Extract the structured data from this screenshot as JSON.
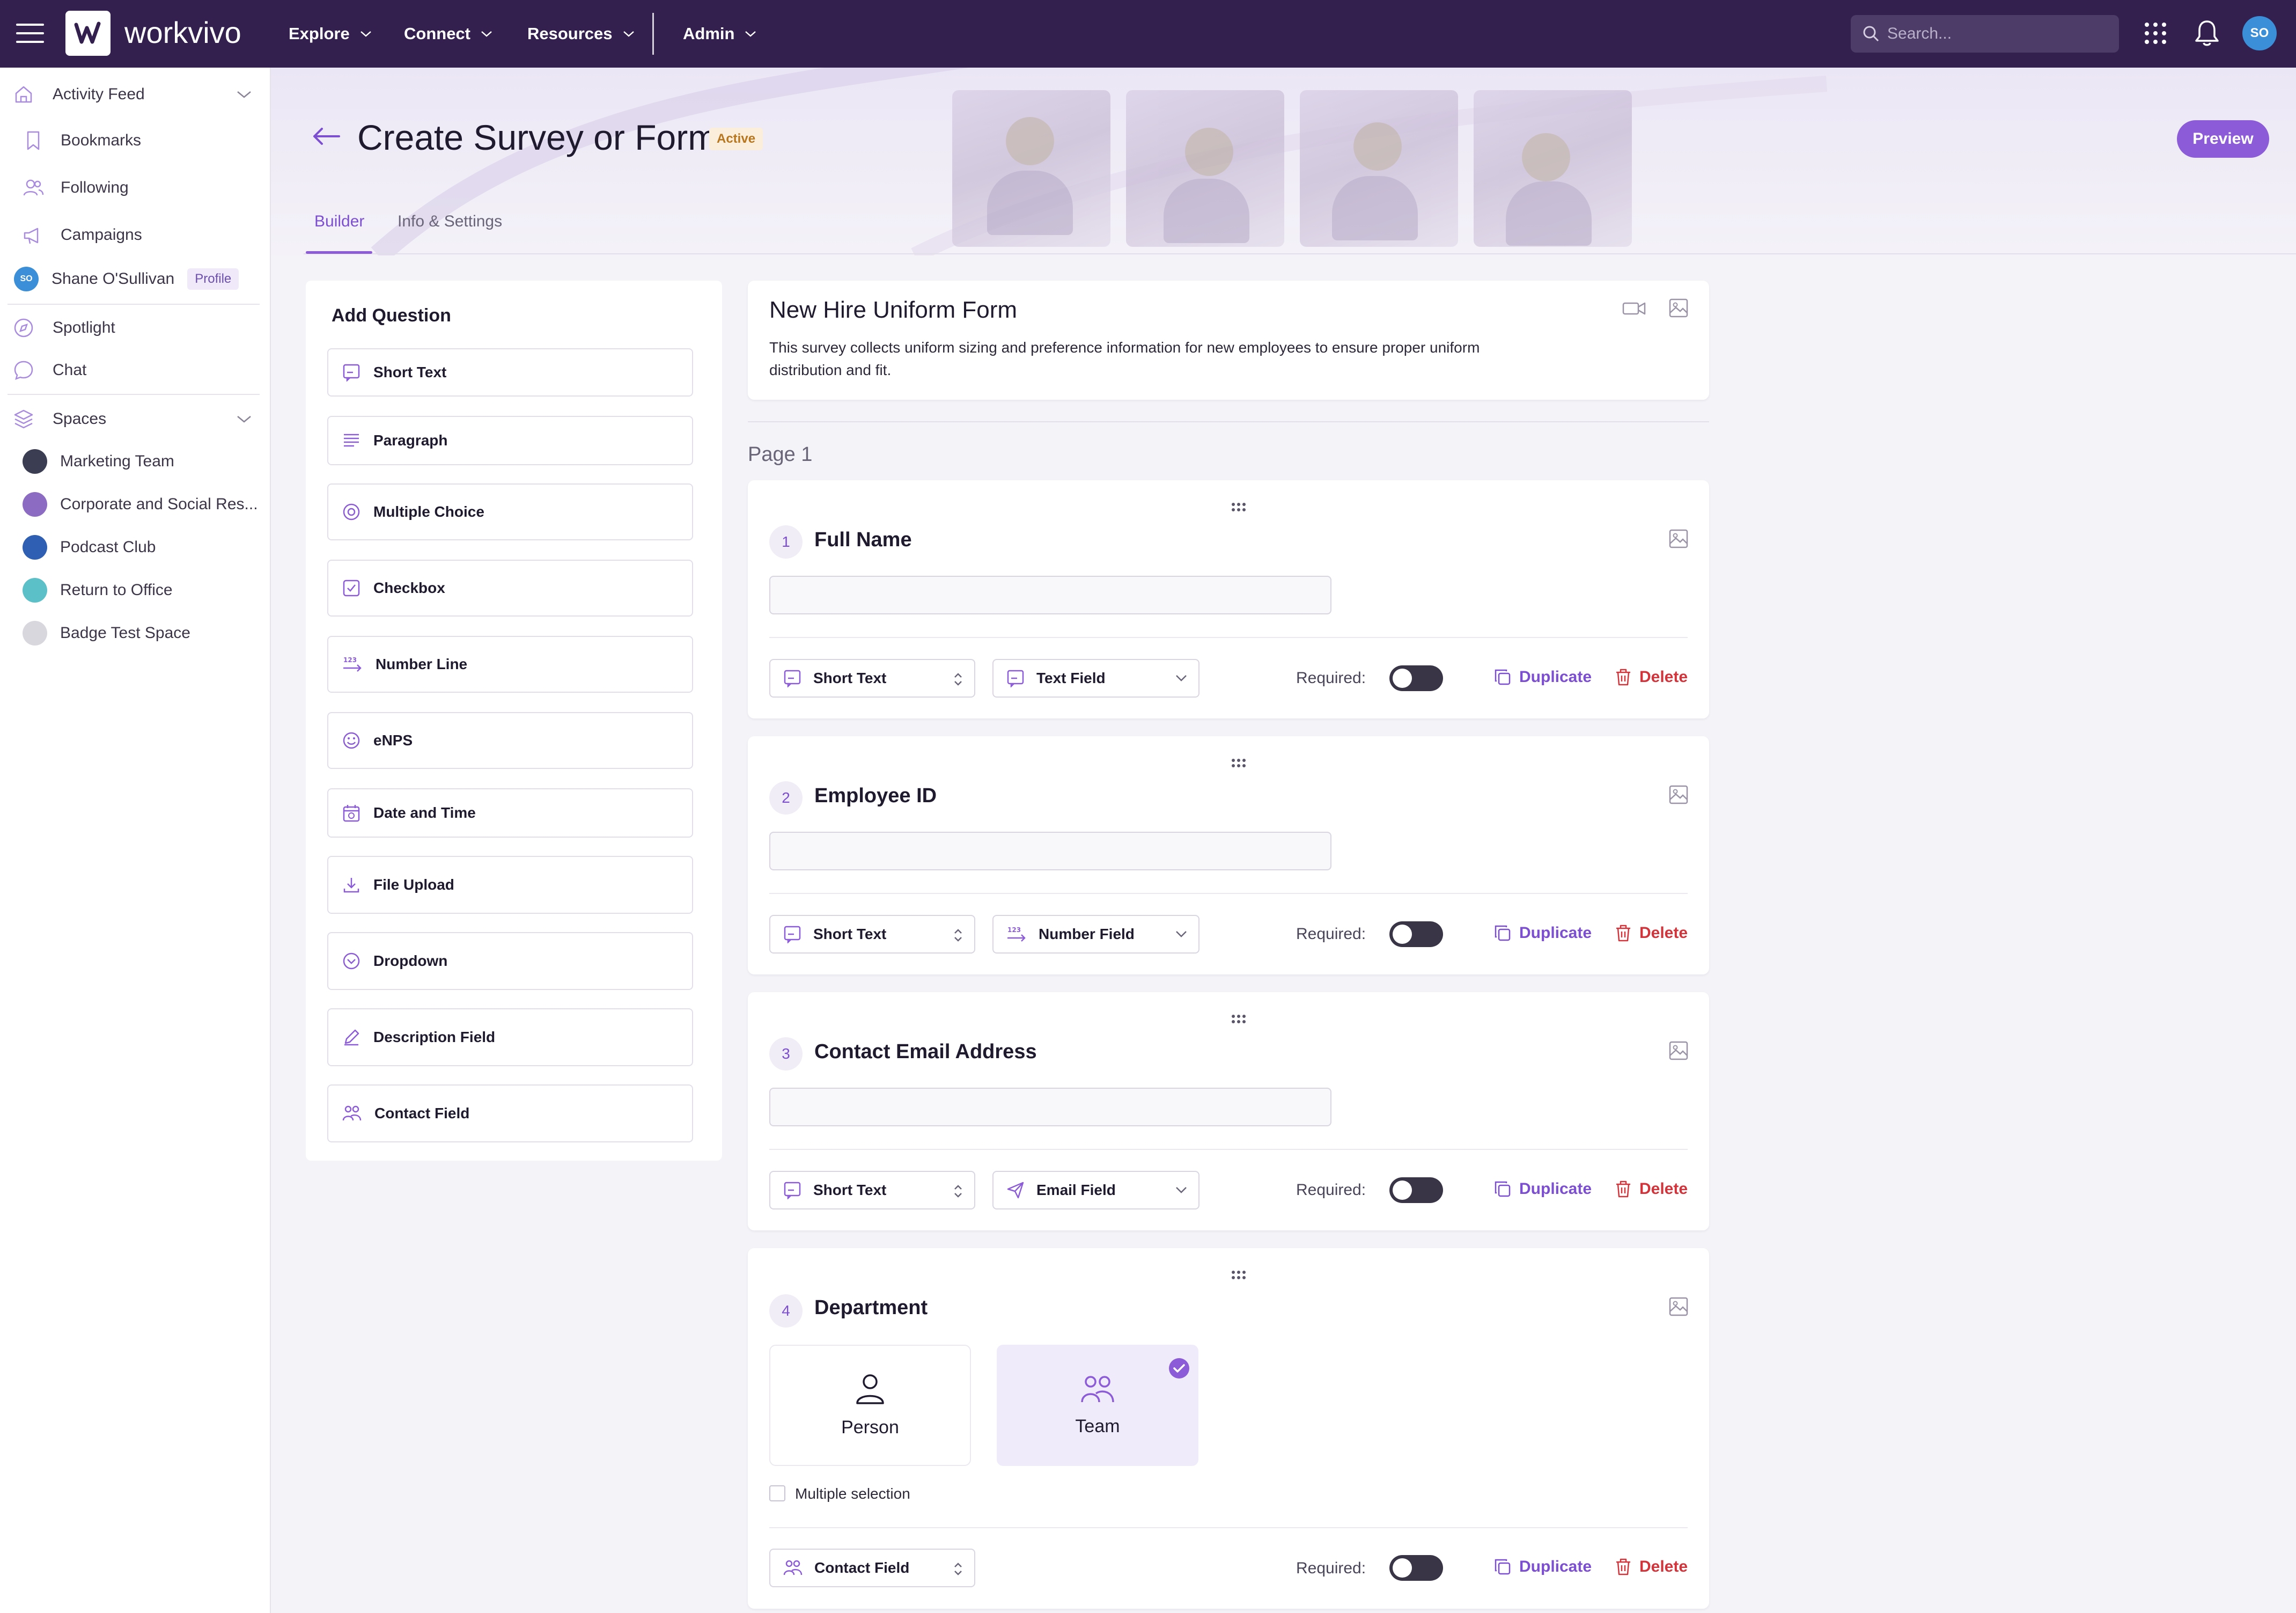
{
  "app": {
    "brand": "workvivo",
    "nav": [
      "Explore",
      "Connect",
      "Resources",
      "Admin"
    ],
    "search_placeholder": "Search...",
    "user_initials": "SO"
  },
  "sidebar": {
    "items": [
      {
        "label": "Activity Feed",
        "icon": "home-icon"
      },
      {
        "label": "Bookmarks",
        "icon": "bookmark-icon"
      },
      {
        "label": "Following",
        "icon": "users-icon"
      },
      {
        "label": "Campaigns",
        "icon": "megaphone-icon"
      }
    ],
    "profile": {
      "name": "Shane O'Sullivan",
      "badge": "Profile",
      "initials": "SO"
    },
    "items2": [
      {
        "label": "Spotlight",
        "icon": "compass-icon"
      },
      {
        "label": "Chat",
        "icon": "chat-icon"
      }
    ],
    "spaces_label": "Spaces",
    "spaces": [
      {
        "label": "Marketing Team",
        "color": "#3b3d52"
      },
      {
        "label": "Corporate and Social Res...",
        "color": "#8c6bc2"
      },
      {
        "label": "Podcast Club",
        "color": "#2f5fb3"
      },
      {
        "label": "Return to Office",
        "color": "#5cc0c8"
      },
      {
        "label": "Badge Test Space",
        "color": "#d9d7de"
      }
    ]
  },
  "header": {
    "title": "Create Survey or Form",
    "status": "Active",
    "preview_label": "Preview",
    "tabs": [
      "Builder",
      "Info & Settings"
    ],
    "active_tab": "Builder"
  },
  "add_question": {
    "title": "Add Question",
    "items": [
      {
        "label": "Short Text",
        "icon": "short-text-icon"
      },
      {
        "label": "Paragraph",
        "icon": "paragraph-icon"
      },
      {
        "label": "Multiple Choice",
        "icon": "radio-icon"
      },
      {
        "label": "Checkbox",
        "icon": "checkbox-icon"
      },
      {
        "label": "Number Line",
        "icon": "number-line-icon"
      },
      {
        "label": "eNPS",
        "icon": "smiley-icon"
      },
      {
        "label": "Date and Time",
        "icon": "calendar-icon"
      },
      {
        "label": "File Upload",
        "icon": "upload-icon"
      },
      {
        "label": "Dropdown",
        "icon": "dropdown-icon"
      },
      {
        "label": "Description Field",
        "icon": "pencil-icon"
      },
      {
        "label": "Contact Field",
        "icon": "contact-icon"
      }
    ]
  },
  "form": {
    "title": "New Hire Uniform Form",
    "description": "This survey collects uniform sizing and preference information for new employees to ensure proper uniform distribution and fit.",
    "page_label": "Page 1"
  },
  "questions": [
    {
      "number": "1",
      "title": "Full Name",
      "type": "Short Text",
      "subtype": "Text Field",
      "required_label": "Required:",
      "required": false
    },
    {
      "number": "2",
      "title": "Employee ID",
      "type": "Short Text",
      "subtype": "Number Field",
      "required_label": "Required:",
      "required": false
    },
    {
      "number": "3",
      "title": "Contact Email Address",
      "type": "Short Text",
      "subtype": "Email Field",
      "required_label": "Required:",
      "required": false
    },
    {
      "number": "4",
      "title": "Department",
      "type": "Contact Field",
      "required_label": "Required:",
      "required": false,
      "options": [
        "Person",
        "Team"
      ],
      "selected_option": "Team",
      "multiple_selection_label": "Multiple selection",
      "multiple_selection": false
    }
  ],
  "actions": {
    "duplicate": "Duplicate",
    "delete": "Delete"
  },
  "colors": {
    "topbar": "#33204f",
    "accent": "#8c5bd8",
    "danger": "#d1343b"
  }
}
